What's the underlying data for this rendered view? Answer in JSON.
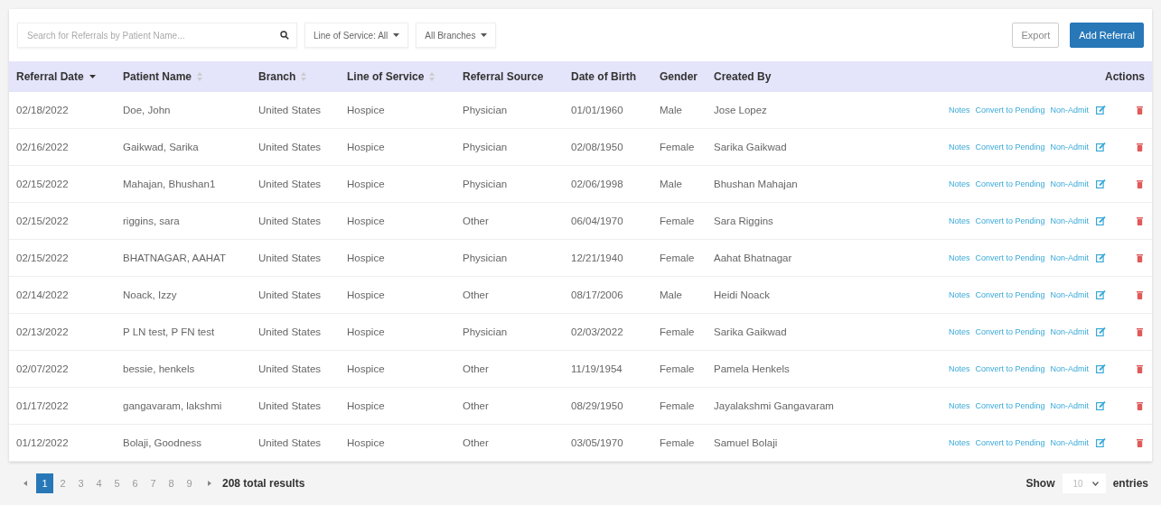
{
  "toolbar": {
    "search": {
      "placeholder": "Search for Referrals by Patient Name..."
    },
    "filters": [
      "Line of Service: All",
      "All Branches"
    ],
    "buttons": [
      {
        "label": "Export",
        "kind": "outline"
      },
      {
        "label": "Add Referral",
        "kind": "primary"
      }
    ]
  },
  "table": {
    "columns": [
      {
        "label": "Referral Date",
        "sorted": true
      },
      {
        "label": "Patient Name",
        "sorted": false
      },
      {
        "label": "Branch",
        "sorted": false
      },
      {
        "label": "Line of Service",
        "sorted": false
      },
      {
        "label": "Referral Source"
      },
      {
        "label": "Date of Birth"
      },
      {
        "label": "Gender"
      },
      {
        "label": "Created By"
      },
      {
        "label": "Actions"
      }
    ],
    "rows": [
      {
        "cells": [
          "02/18/2022",
          "Doe, John",
          "United States",
          "Hospice",
          "Physician",
          "01/01/1960",
          "Male",
          "Jose Lopez"
        ],
        "actions": [
          "Notes",
          "Convert to Pending",
          "Non-Admit"
        ]
      },
      {
        "cells": [
          "02/16/2022",
          "Gaikwad, Sarika",
          "United States",
          "Hospice",
          "Physician",
          "02/08/1950",
          "Female",
          "Sarika Gaikwad"
        ],
        "actions": [
          "Notes",
          "Convert to Pending",
          "Non-Admit"
        ]
      },
      {
        "cells": [
          "02/15/2022",
          "Mahajan, Bhushan1",
          "United States",
          "Hospice",
          "Physician",
          "02/06/1998",
          "Male",
          "Bhushan Mahajan"
        ],
        "actions": [
          "Notes",
          "Convert to Pending",
          "Non-Admit"
        ]
      },
      {
        "cells": [
          "02/15/2022",
          "riggins, sara",
          "United States",
          "Hospice",
          "Other",
          "06/04/1970",
          "Female",
          "Sara Riggins"
        ],
        "actions": [
          "Notes",
          "Convert to Pending",
          "Non-Admit"
        ]
      },
      {
        "cells": [
          "02/15/2022",
          "BHATNAGAR, AAHAT",
          "United States",
          "Hospice",
          "Physician",
          "12/21/1940",
          "Female",
          "Aahat Bhatnagar"
        ],
        "actions": [
          "Notes",
          "Convert to Pending",
          "Non-Admit"
        ]
      },
      {
        "cells": [
          "02/14/2022",
          "Noack, Izzy",
          "United States",
          "Hospice",
          "Other",
          "08/17/2006",
          "Male",
          "Heidi Noack"
        ],
        "actions": [
          "Notes",
          "Convert to Pending",
          "Non-Admit"
        ]
      },
      {
        "cells": [
          "02/13/2022",
          "P LN test, P FN test",
          "United States",
          "Hospice",
          "Physician",
          "02/03/2022",
          "Female",
          "Sarika Gaikwad"
        ],
        "actions": [
          "Notes",
          "Convert to Pending",
          "Non-Admit"
        ]
      },
      {
        "cells": [
          "02/07/2022",
          "bessie, henkels",
          "United States",
          "Hospice",
          "Other",
          "11/19/1954",
          "Female",
          "Pamela Henkels"
        ],
        "actions": [
          "Notes",
          "Convert to Pending",
          "Non-Admit"
        ]
      },
      {
        "cells": [
          "01/17/2022",
          "gangavaram, lakshmi",
          "United States",
          "Hospice",
          "Other",
          "08/29/1950",
          "Female",
          "Jayalakshmi Gangavaram"
        ],
        "actions": [
          "Notes",
          "Convert to Pending",
          "Non-Admit"
        ]
      },
      {
        "cells": [
          "01/12/2022",
          "Bolaji, Goodness",
          "United States",
          "Hospice",
          "Other",
          "03/05/1970",
          "Female",
          "Samuel Bolaji"
        ],
        "actions": [
          "Notes",
          "Convert to Pending",
          "Non-Admit"
        ]
      }
    ]
  },
  "pagination": {
    "pages": [
      {
        "label": "1",
        "selected": true
      },
      {
        "label": "2",
        "selected": false
      },
      {
        "label": "3",
        "selected": false
      },
      {
        "label": "4",
        "selected": false
      },
      {
        "label": "5",
        "selected": false
      },
      {
        "label": "6",
        "selected": false
      },
      {
        "label": "7",
        "selected": false
      },
      {
        "label": "8",
        "selected": false
      },
      {
        "label": "9",
        "selected": false
      }
    ],
    "total": "208 total results",
    "show_label": "Show",
    "page_size": "10",
    "entries_label": "entries"
  }
}
